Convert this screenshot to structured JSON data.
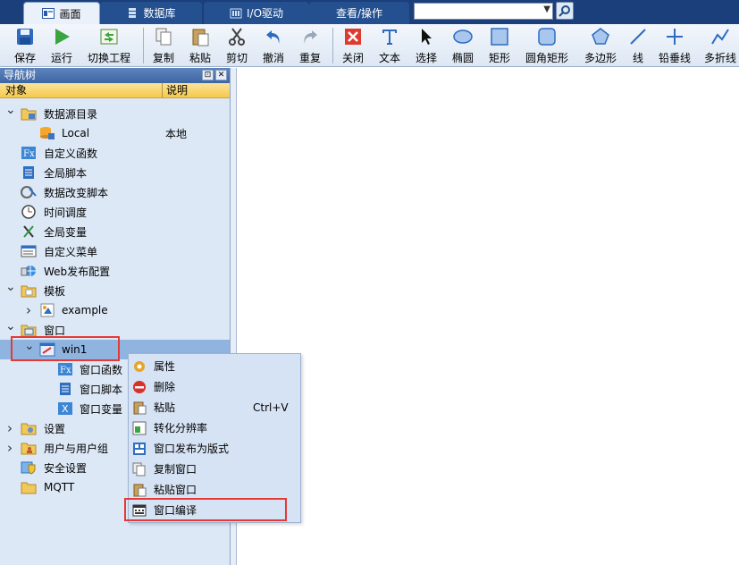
{
  "tabs": [
    {
      "label": "画面",
      "icon": "screen-icon",
      "active": true
    },
    {
      "label": "数据库",
      "icon": "database-icon",
      "active": false
    },
    {
      "label": "I/O驱动",
      "icon": "io-driver-icon",
      "active": false
    },
    {
      "label": "查看/操作",
      "icon": "",
      "active": false
    }
  ],
  "search": {
    "value": ""
  },
  "toolbar": [
    {
      "label": "保存",
      "icon": "save-icon"
    },
    {
      "label": "运行",
      "icon": "run-icon"
    },
    {
      "label": "切换工程",
      "icon": "switch-project-icon"
    },
    {
      "label": "复制",
      "icon": "copy-icon"
    },
    {
      "label": "粘贴",
      "icon": "paste-icon"
    },
    {
      "label": "剪切",
      "icon": "cut-icon"
    },
    {
      "label": "撤消",
      "icon": "undo-icon"
    },
    {
      "label": "重复",
      "icon": "redo-icon"
    },
    {
      "label": "关闭",
      "icon": "close-icon"
    },
    {
      "label": "文本",
      "icon": "text-icon"
    },
    {
      "label": "选择",
      "icon": "select-cursor-icon"
    },
    {
      "label": "椭圆",
      "icon": "ellipse-icon"
    },
    {
      "label": "矩形",
      "icon": "rectangle-icon"
    },
    {
      "label": "圆角矩形",
      "icon": "rounded-rectangle-icon"
    },
    {
      "label": "多边形",
      "icon": "polygon-icon"
    },
    {
      "label": "线",
      "icon": "line-icon"
    },
    {
      "label": "铅垂线",
      "icon": "plumb-line-icon"
    },
    {
      "label": "多折线",
      "icon": "polyline-icon"
    }
  ],
  "nav": {
    "title": "导航树",
    "col_object": "对象",
    "col_desc": "说明",
    "items": [
      {
        "label": "数据源目录",
        "desc": "",
        "icon": "data-source-folder-icon",
        "chevron": "v"
      },
      {
        "label": "Local",
        "desc": "本地",
        "icon": "local-database-icon",
        "chevron": ""
      },
      {
        "label": "自定义函数",
        "desc": "",
        "icon": "function-fx-icon",
        "chevron": ""
      },
      {
        "label": "全局脚本",
        "desc": "",
        "icon": "script-icon",
        "chevron": ""
      },
      {
        "label": "数据改变脚本",
        "desc": "",
        "icon": "data-change-script-icon",
        "chevron": ""
      },
      {
        "label": "时间调度",
        "desc": "",
        "icon": "clock-icon",
        "chevron": ""
      },
      {
        "label": "全局变量",
        "desc": "",
        "icon": "variable-icon",
        "chevron": ""
      },
      {
        "label": "自定义菜单",
        "desc": "",
        "icon": "menu-icon",
        "chevron": ""
      },
      {
        "label": "Web发布配置",
        "desc": "",
        "icon": "web-publish-icon",
        "chevron": ""
      },
      {
        "label": "模板",
        "desc": "",
        "icon": "template-folder-icon",
        "chevron": "v"
      },
      {
        "label": "example",
        "desc": "",
        "icon": "template-item-icon",
        "chevron": ">"
      },
      {
        "label": "窗口",
        "desc": "",
        "icon": "window-folder-icon",
        "chevron": "v"
      },
      {
        "label": "win1",
        "desc": "",
        "icon": "window-item-icon",
        "chevron": "v"
      },
      {
        "label": "窗口函数",
        "desc": "",
        "icon": "function-fx-icon",
        "chevron": ""
      },
      {
        "label": "窗口脚本",
        "desc": "",
        "icon": "script-icon",
        "chevron": ""
      },
      {
        "label": "窗口变量",
        "desc": "",
        "icon": "variable-x-icon",
        "chevron": ""
      },
      {
        "label": "设置",
        "desc": "",
        "icon": "settings-folder-icon",
        "chevron": ">"
      },
      {
        "label": "用户与用户组",
        "desc": "",
        "icon": "users-folder-icon",
        "chevron": ">"
      },
      {
        "label": "安全设置",
        "desc": "",
        "icon": "security-icon",
        "chevron": ""
      },
      {
        "label": "MQTT",
        "desc": "",
        "icon": "folder-icon",
        "chevron": ""
      }
    ]
  },
  "context_menu": [
    {
      "label": "属性",
      "shortcut": "",
      "icon": "properties-gear-icon"
    },
    {
      "label": "删除",
      "shortcut": "",
      "icon": "delete-icon"
    },
    {
      "label": "粘贴",
      "shortcut": "Ctrl+V",
      "icon": "paste-icon"
    },
    {
      "label": "转化分辨率",
      "shortcut": "",
      "icon": "resolution-icon"
    },
    {
      "label": "窗口发布为版式",
      "shortcut": "",
      "icon": "publish-layout-icon"
    },
    {
      "label": "复制窗口",
      "shortcut": "",
      "icon": "copy-window-icon"
    },
    {
      "label": "粘贴窗口",
      "shortcut": "",
      "icon": "paste-window-icon"
    },
    {
      "label": "窗口编译",
      "shortcut": "",
      "icon": "compile-window-icon"
    }
  ]
}
